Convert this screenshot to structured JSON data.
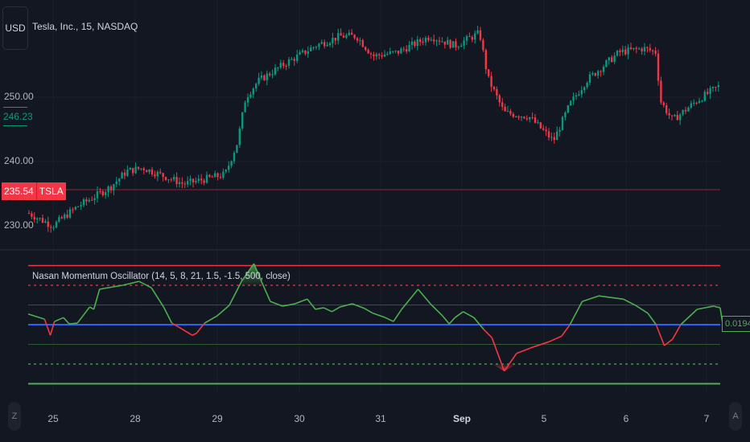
{
  "header": {
    "currency": "USD",
    "symbol_title": "Tesla, Inc., 15, NASDAQ"
  },
  "price_axis": {
    "labels": [
      "250.00",
      "240.00",
      "230.00"
    ],
    "current_marker": "246.23",
    "last_price": "235.54",
    "last_ticker": "TSLA"
  },
  "indicator": {
    "title": "Nasan Momentum Oscillator (14, 5, 8, 21, 1.5, -1.5, 500, close)",
    "value": "0.0194"
  },
  "time_axis": {
    "labels": [
      "25",
      "28",
      "29",
      "30",
      "31",
      "Sep",
      "5",
      "6",
      "7"
    ],
    "bold_index": 5
  },
  "buttons": {
    "left": "Z",
    "right": "A"
  },
  "colors": {
    "up": "#089981",
    "down": "#f23645",
    "osc_up": "#4caf50",
    "osc_down": "#f23645",
    "zero": "#2962ff"
  },
  "chart_data": [
    {
      "type": "candlestick",
      "title": "Tesla, Inc., 15, NASDAQ",
      "ylim": [
        228,
        263
      ],
      "yticks": [
        230,
        240,
        250
      ],
      "close_path": [
        [
          0,
          232
        ],
        [
          3,
          230
        ],
        [
          6,
          233
        ],
        [
          10,
          236
        ],
        [
          12,
          238.5
        ],
        [
          14,
          239
        ],
        [
          19,
          236.5
        ],
        [
          24,
          238
        ],
        [
          25.5,
          243
        ],
        [
          26.5,
          250
        ],
        [
          28,
          252.5
        ],
        [
          31,
          255
        ],
        [
          35,
          258
        ],
        [
          38,
          259.5
        ],
        [
          40,
          259.5
        ],
        [
          42,
          256.4
        ],
        [
          45,
          257
        ],
        [
          49,
          259.5
        ],
        [
          52,
          258
        ],
        [
          55,
          260
        ],
        [
          56,
          253
        ],
        [
          58,
          247.6
        ],
        [
          61,
          247
        ],
        [
          64,
          243.2
        ],
        [
          66,
          248.9
        ],
        [
          68,
          252.6
        ],
        [
          72,
          257
        ],
        [
          75,
          257.6
        ],
        [
          76.5,
          257
        ],
        [
          77,
          249.5
        ],
        [
          78.5,
          246.4
        ],
        [
          81.5,
          249.5
        ],
        [
          84.5,
          252
        ],
        [
          86,
          252
        ],
        [
          86.5,
          247.6
        ],
        [
          88,
          245.8
        ]
      ]
    },
    {
      "type": "line",
      "title": "Nasan Momentum Oscillator",
      "ylim": [
        -1.6,
        1.6
      ],
      "levels": [
        1.5,
        1.0,
        0.5,
        0,
        -0.5,
        -1.0,
        -1.5
      ],
      "points": [
        [
          0,
          0.27
        ],
        [
          2,
          0.14
        ],
        [
          2.7,
          -0.27
        ],
        [
          3.2,
          0.08
        ],
        [
          4.3,
          0.18
        ],
        [
          5,
          0.02
        ],
        [
          6,
          0.04
        ],
        [
          7.5,
          0.45
        ],
        [
          8,
          0.39
        ],
        [
          8.7,
          0.9
        ],
        [
          11.5,
          1.0
        ],
        [
          13.5,
          1.1
        ],
        [
          15,
          0.94
        ],
        [
          16.5,
          0.45
        ],
        [
          17.5,
          0.04
        ],
        [
          18.5,
          -0.08
        ],
        [
          20,
          -0.27
        ],
        [
          20.5,
          -0.22
        ],
        [
          21.5,
          0.04
        ],
        [
          23,
          0.22
        ],
        [
          24.5,
          0.49
        ],
        [
          26,
          1.1
        ],
        [
          27.5,
          1.55
        ],
        [
          28.5,
          1.06
        ],
        [
          29.5,
          0.59
        ],
        [
          31,
          0.47
        ],
        [
          32.5,
          0.53
        ],
        [
          34,
          0.65
        ],
        [
          35,
          0.39
        ],
        [
          36,
          0.43
        ],
        [
          37,
          0.33
        ],
        [
          38,
          0.45
        ],
        [
          39.5,
          0.53
        ],
        [
          41,
          0.41
        ],
        [
          42,
          0.29
        ],
        [
          43.5,
          0.18
        ],
        [
          44.5,
          0.08
        ],
        [
          45.5,
          0.39
        ],
        [
          47.5,
          0.9
        ],
        [
          49,
          0.53
        ],
        [
          50.5,
          0.22
        ],
        [
          51.3,
          0.02
        ],
        [
          52,
          0.18
        ],
        [
          53,
          0.33
        ],
        [
          54.3,
          0.18
        ],
        [
          55.5,
          -0.12
        ],
        [
          56.5,
          -0.33
        ],
        [
          58,
          -1.18
        ],
        [
          59.5,
          -0.73
        ],
        [
          61.5,
          -0.57
        ],
        [
          63.5,
          -0.43
        ],
        [
          65,
          -0.29
        ],
        [
          66,
          0.0
        ],
        [
          67.5,
          0.59
        ],
        [
          69.5,
          0.73
        ],
        [
          72.5,
          0.65
        ],
        [
          74,
          0.49
        ],
        [
          75.5,
          0.29
        ],
        [
          76.5,
          0.0
        ],
        [
          77.5,
          -0.53
        ],
        [
          78.5,
          -0.37
        ],
        [
          79.5,
          0.0
        ],
        [
          81.5,
          0.39
        ],
        [
          83.5,
          0.47
        ],
        [
          84.3,
          0.43
        ],
        [
          84.7,
          -0.08
        ],
        [
          86,
          0.08
        ],
        [
          87,
          0.02
        ]
      ]
    }
  ]
}
